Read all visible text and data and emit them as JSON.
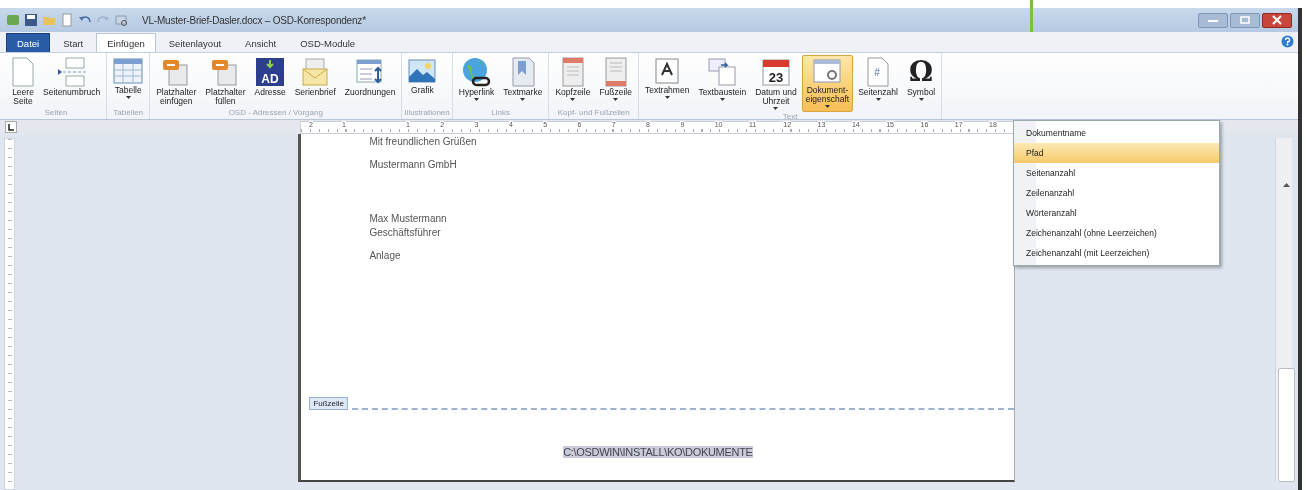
{
  "window": {
    "title": "VL-Muster-Brief-Dasler.docx – OSD-Korrespondenz*"
  },
  "tabs": [
    {
      "label": "Datei",
      "kind": "file",
      "selected": false
    },
    {
      "label": "Start",
      "kind": "tab",
      "selected": false
    },
    {
      "label": "Einfügen",
      "kind": "tab",
      "selected": true
    },
    {
      "label": "Seitenlayout",
      "kind": "tab",
      "selected": false
    },
    {
      "label": "Ansicht",
      "kind": "tab",
      "selected": false
    },
    {
      "label": "OSD-Module",
      "kind": "tab",
      "selected": false
    }
  ],
  "ribbon": {
    "groups": [
      {
        "label": "Seiten",
        "buttons": [
          {
            "label": "Leere\nSeite",
            "kind": "page",
            "has_menu": false,
            "selected": false
          },
          {
            "label": "Seitenumbruch",
            "kind": "pagebreak",
            "has_menu": false,
            "selected": false
          }
        ]
      },
      {
        "label": "Tabellen",
        "buttons": [
          {
            "label": "Tabelle",
            "kind": "table",
            "has_menu": true,
            "selected": false
          }
        ]
      },
      {
        "label": "OSD - Adressen / Vorgang",
        "buttons": [
          {
            "label": "Platzhalter\neinfügen",
            "kind": "placeholder",
            "has_menu": false,
            "selected": false
          },
          {
            "label": "Platzhalter\nfüllen",
            "kind": "placeholder",
            "has_menu": false,
            "selected": false
          },
          {
            "label": "Adresse",
            "kind": "address",
            "icon_text": "AD",
            "has_menu": false,
            "selected": false
          },
          {
            "label": "Serienbrief",
            "kind": "mailmerge",
            "has_menu": false,
            "selected": false
          },
          {
            "label": "Zuordnungen",
            "kind": "mapping",
            "has_menu": false,
            "selected": false
          }
        ]
      },
      {
        "label": "Illustrationen",
        "buttons": [
          {
            "label": "Grafik",
            "kind": "picture",
            "has_menu": false,
            "selected": false
          }
        ]
      },
      {
        "label": "Links",
        "buttons": [
          {
            "label": "Hyperlink",
            "kind": "globe",
            "has_menu": true,
            "selected": false
          },
          {
            "label": "Textmarke",
            "kind": "bookmark",
            "has_menu": true,
            "selected": false
          }
        ]
      },
      {
        "label": "Kopf- und Fußzeilen",
        "buttons": [
          {
            "label": "Kopfzeile",
            "kind": "header",
            "has_menu": true,
            "selected": false
          },
          {
            "label": "Fußzeile",
            "kind": "footer",
            "has_menu": true,
            "selected": false
          }
        ]
      },
      {
        "label": "Text",
        "buttons": [
          {
            "label": "Textrahmen",
            "kind": "textframe",
            "has_menu": true,
            "selected": false
          },
          {
            "label": "Textbaustein",
            "kind": "textblock",
            "has_menu": true,
            "selected": false
          },
          {
            "label": "Datum und\nUhrzeit",
            "kind": "calendar",
            "icon_text": "23",
            "has_menu": true,
            "selected": false
          },
          {
            "label": "Dokument-\neigenschaft",
            "kind": "docprop",
            "has_menu": true,
            "selected": true
          },
          {
            "label": "Seitenzahl",
            "kind": "pagenumber",
            "icon_text": "#",
            "has_menu": true,
            "selected": false
          },
          {
            "label": "Symbol",
            "kind": "omega",
            "icon_text": "Ω",
            "has_menu": true,
            "selected": false
          }
        ]
      }
    ]
  },
  "menu": {
    "items": [
      {
        "label": "Dokumentname",
        "selected": false
      },
      {
        "label": "Pfad",
        "selected": true
      },
      {
        "label": "Seitenanzahl",
        "selected": false
      },
      {
        "label": "Zeilenanzahl",
        "selected": false
      },
      {
        "label": "Wörteranzahl",
        "selected": false
      },
      {
        "label": "Zeichenanzahl (ohne Leerzeichen)",
        "selected": false
      },
      {
        "label": "Zeichenanzahl (mit Leerzeichen)",
        "selected": false
      }
    ]
  },
  "ruler": {
    "left_numbers": [
      "2",
      "1"
    ],
    "numbers": [
      "1",
      "2",
      "3",
      "4",
      "5",
      "6",
      "7",
      "8",
      "9",
      "10",
      "11",
      "12",
      "13",
      "14",
      "15",
      "16",
      "17",
      "18"
    ]
  },
  "document": {
    "blocks": [
      [
        "Mit freundlichen Grüßen"
      ],
      [
        "Mustermann GmbH"
      ],
      [
        "Max Mustermann",
        "Geschäftsführer"
      ],
      [
        "Anlage"
      ]
    ],
    "footer_tag": "Fußzeile",
    "footer_field": {
      "text": "C:\\OSDWIN\\INSTALL\\KO\\DOKUMENTE",
      "shaded": true
    }
  }
}
